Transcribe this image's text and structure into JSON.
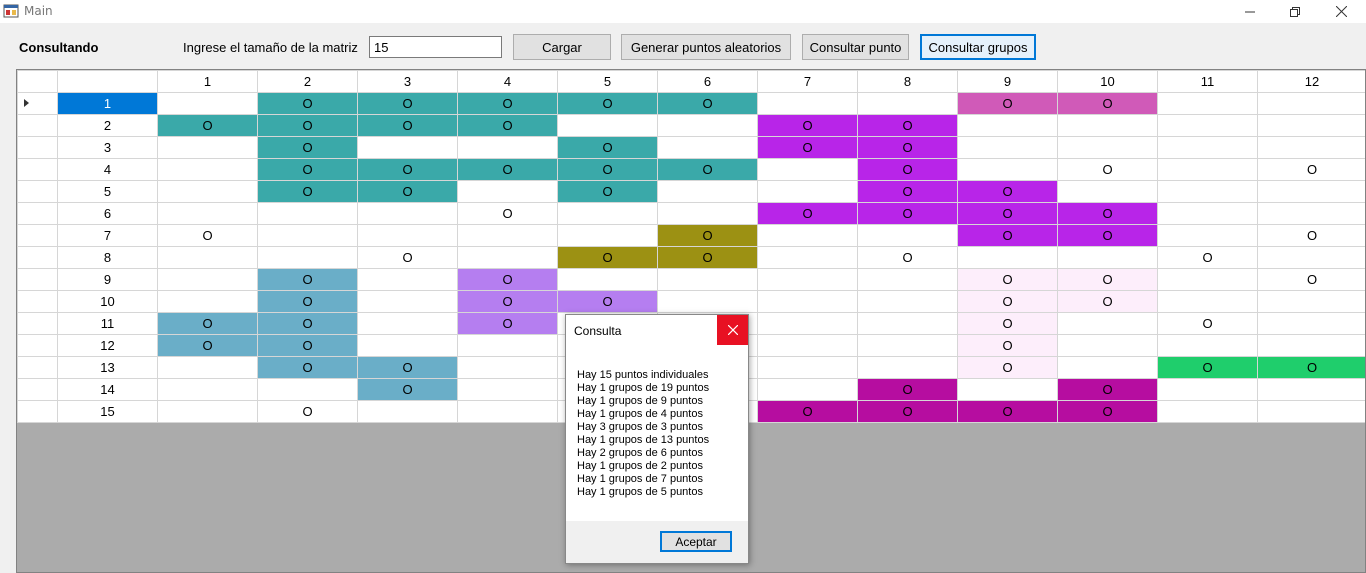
{
  "window": {
    "title": "Main"
  },
  "toolbar": {
    "status_label": "Consultando",
    "size_label": "Ingrese el tamaño de la matriz",
    "size_value": "15",
    "load_button": "Cargar",
    "random_button": "Generar puntos aleatorios",
    "query_point_button": "Consultar punto",
    "query_groups_button": "Consultar grupos"
  },
  "grid": {
    "columns": [
      "",
      "1",
      "2",
      "3",
      "4",
      "5",
      "6",
      "7",
      "8",
      "9",
      "10",
      "11",
      "12"
    ],
    "rows": [
      {
        "label": "1",
        "cells": [
          [
            " ",
            ""
          ],
          [
            "O",
            "teal"
          ],
          [
            "O",
            "teal"
          ],
          [
            "O",
            "teal"
          ],
          [
            "O",
            "teal"
          ],
          [
            "O",
            "teal"
          ],
          [
            " ",
            ""
          ],
          [
            " ",
            ""
          ],
          [
            "O",
            "orchid"
          ],
          [
            "O",
            "orchid"
          ],
          [
            " ",
            ""
          ],
          [
            " ",
            ""
          ]
        ]
      },
      {
        "label": "2",
        "cells": [
          [
            "O",
            "teal"
          ],
          [
            "O",
            "teal"
          ],
          [
            "O",
            "teal"
          ],
          [
            "O",
            "teal"
          ],
          [
            " ",
            ""
          ],
          [
            " ",
            ""
          ],
          [
            "O",
            "purple"
          ],
          [
            "O",
            "purple"
          ],
          [
            " ",
            ""
          ],
          [
            " ",
            ""
          ],
          [
            " ",
            ""
          ],
          [
            " ",
            ""
          ]
        ]
      },
      {
        "label": "3",
        "cells": [
          [
            " ",
            ""
          ],
          [
            "O",
            "teal"
          ],
          [
            " ",
            ""
          ],
          [
            " ",
            ""
          ],
          [
            "O",
            "teal"
          ],
          [
            " ",
            ""
          ],
          [
            "O",
            "purple"
          ],
          [
            "O",
            "purple"
          ],
          [
            " ",
            ""
          ],
          [
            " ",
            ""
          ],
          [
            " ",
            ""
          ],
          [
            " ",
            ""
          ]
        ]
      },
      {
        "label": "4",
        "cells": [
          [
            " ",
            ""
          ],
          [
            "O",
            "teal"
          ],
          [
            "O",
            "teal"
          ],
          [
            "O",
            "teal"
          ],
          [
            "O",
            "teal"
          ],
          [
            "O",
            "teal"
          ],
          [
            " ",
            ""
          ],
          [
            "O",
            "purple"
          ],
          [
            " ",
            ""
          ],
          [
            "O",
            ""
          ],
          [
            " ",
            ""
          ],
          [
            "O",
            ""
          ]
        ]
      },
      {
        "label": "5",
        "cells": [
          [
            " ",
            ""
          ],
          [
            "O",
            "teal"
          ],
          [
            "O",
            "teal"
          ],
          [
            " ",
            ""
          ],
          [
            "O",
            "teal"
          ],
          [
            " ",
            ""
          ],
          [
            " ",
            ""
          ],
          [
            "O",
            "purple"
          ],
          [
            "O",
            "purple"
          ],
          [
            " ",
            ""
          ],
          [
            " ",
            ""
          ],
          [
            " ",
            ""
          ]
        ]
      },
      {
        "label": "6",
        "cells": [
          [
            " ",
            ""
          ],
          [
            " ",
            ""
          ],
          [
            " ",
            ""
          ],
          [
            "O",
            ""
          ],
          [
            " ",
            ""
          ],
          [
            " ",
            ""
          ],
          [
            "O",
            "purple"
          ],
          [
            "O",
            "purple"
          ],
          [
            "O",
            "purple"
          ],
          [
            "O",
            "purple"
          ],
          [
            " ",
            ""
          ],
          [
            " ",
            ""
          ]
        ]
      },
      {
        "label": "7",
        "cells": [
          [
            "O",
            ""
          ],
          [
            " ",
            ""
          ],
          [
            " ",
            ""
          ],
          [
            " ",
            ""
          ],
          [
            " ",
            ""
          ],
          [
            "O",
            "olive"
          ],
          [
            " ",
            ""
          ],
          [
            " ",
            ""
          ],
          [
            "O",
            "purple"
          ],
          [
            "O",
            "purple"
          ],
          [
            " ",
            ""
          ],
          [
            "O",
            ""
          ]
        ]
      },
      {
        "label": "8",
        "cells": [
          [
            " ",
            ""
          ],
          [
            " ",
            ""
          ],
          [
            "O",
            ""
          ],
          [
            " ",
            ""
          ],
          [
            "O",
            "olive"
          ],
          [
            "O",
            "olive"
          ],
          [
            " ",
            ""
          ],
          [
            "O",
            ""
          ],
          [
            " ",
            ""
          ],
          [
            " ",
            ""
          ],
          [
            "O",
            ""
          ],
          [
            " ",
            ""
          ]
        ]
      },
      {
        "label": "9",
        "cells": [
          [
            " ",
            ""
          ],
          [
            "O",
            "steel"
          ],
          [
            " ",
            ""
          ],
          [
            "O",
            "lavender"
          ],
          [
            " ",
            ""
          ],
          [
            " ",
            ""
          ],
          [
            " ",
            ""
          ],
          [
            " ",
            ""
          ],
          [
            "O",
            "pink"
          ],
          [
            "O",
            "pink"
          ],
          [
            " ",
            ""
          ],
          [
            "O",
            ""
          ]
        ]
      },
      {
        "label": "10",
        "cells": [
          [
            " ",
            ""
          ],
          [
            "O",
            "steel"
          ],
          [
            " ",
            ""
          ],
          [
            "O",
            "lavender"
          ],
          [
            "O",
            "lavender"
          ],
          [
            " ",
            ""
          ],
          [
            " ",
            ""
          ],
          [
            " ",
            ""
          ],
          [
            "O",
            "pink"
          ],
          [
            "O",
            "pink"
          ],
          [
            " ",
            ""
          ],
          [
            " ",
            ""
          ]
        ]
      },
      {
        "label": "11",
        "cells": [
          [
            "O",
            "steel"
          ],
          [
            "O",
            "steel"
          ],
          [
            " ",
            ""
          ],
          [
            "O",
            "lavender"
          ],
          [
            " ",
            ""
          ],
          [
            " ",
            ""
          ],
          [
            " ",
            ""
          ],
          [
            " ",
            ""
          ],
          [
            "O",
            "pink"
          ],
          [
            " ",
            ""
          ],
          [
            "O",
            ""
          ],
          [
            " ",
            ""
          ]
        ]
      },
      {
        "label": "12",
        "cells": [
          [
            "O",
            "steel"
          ],
          [
            "O",
            "steel"
          ],
          [
            " ",
            ""
          ],
          [
            " ",
            ""
          ],
          [
            " ",
            ""
          ],
          [
            " ",
            ""
          ],
          [
            " ",
            ""
          ],
          [
            " ",
            ""
          ],
          [
            "O",
            "pink"
          ],
          [
            " ",
            ""
          ],
          [
            " ",
            ""
          ],
          [
            " ",
            ""
          ]
        ]
      },
      {
        "label": "13",
        "cells": [
          [
            " ",
            ""
          ],
          [
            "O",
            "steel"
          ],
          [
            "O",
            "steel"
          ],
          [
            " ",
            ""
          ],
          [
            " ",
            ""
          ],
          [
            " ",
            ""
          ],
          [
            " ",
            ""
          ],
          [
            " ",
            ""
          ],
          [
            "O",
            "pink"
          ],
          [
            " ",
            ""
          ],
          [
            "O",
            "green"
          ],
          [
            "O",
            "green"
          ]
        ]
      },
      {
        "label": "14",
        "cells": [
          [
            " ",
            ""
          ],
          [
            " ",
            ""
          ],
          [
            "O",
            "steel"
          ],
          [
            " ",
            ""
          ],
          [
            " ",
            ""
          ],
          [
            " ",
            ""
          ],
          [
            " ",
            ""
          ],
          [
            "O",
            "magenta"
          ],
          [
            " ",
            ""
          ],
          [
            "O",
            "magenta"
          ],
          [
            " ",
            ""
          ],
          [
            " ",
            ""
          ]
        ]
      },
      {
        "label": "15",
        "cells": [
          [
            " ",
            ""
          ],
          [
            "O",
            ""
          ],
          [
            " ",
            ""
          ],
          [
            " ",
            ""
          ],
          [
            " ",
            ""
          ],
          [
            " ",
            ""
          ],
          [
            "O",
            "magenta"
          ],
          [
            "O",
            "magenta"
          ],
          [
            "O",
            "magenta"
          ],
          [
            "O",
            "magenta"
          ],
          [
            " ",
            ""
          ],
          [
            " ",
            ""
          ]
        ]
      }
    ]
  },
  "colors": {
    "teal": "#3aa9a9",
    "orchid": "#d05ab8",
    "purple": "#b825e8",
    "olive": "#9c9113",
    "steel": "#6aaec8",
    "lavender": "#b57ef0",
    "pink": "#fdeefb",
    "green": "#1fce6c",
    "magenta": "#b60da0",
    "selection": "#0078d7"
  },
  "dialog": {
    "title": "Consulta",
    "lines": [
      "Hay 15 puntos individuales",
      "Hay 1 grupos de 19 puntos",
      "Hay 1 grupos de 9 puntos",
      "Hay 1 grupos de 4 puntos",
      "Hay 3 grupos de 3 puntos",
      "Hay 1 grupos de 13 puntos",
      "Hay 2 grupos de 6 puntos",
      "Hay 1 grupos de 2 puntos",
      "Hay 1 grupos de 7 puntos",
      "Hay 1 grupos de 5 puntos"
    ],
    "ok_button": "Aceptar"
  }
}
